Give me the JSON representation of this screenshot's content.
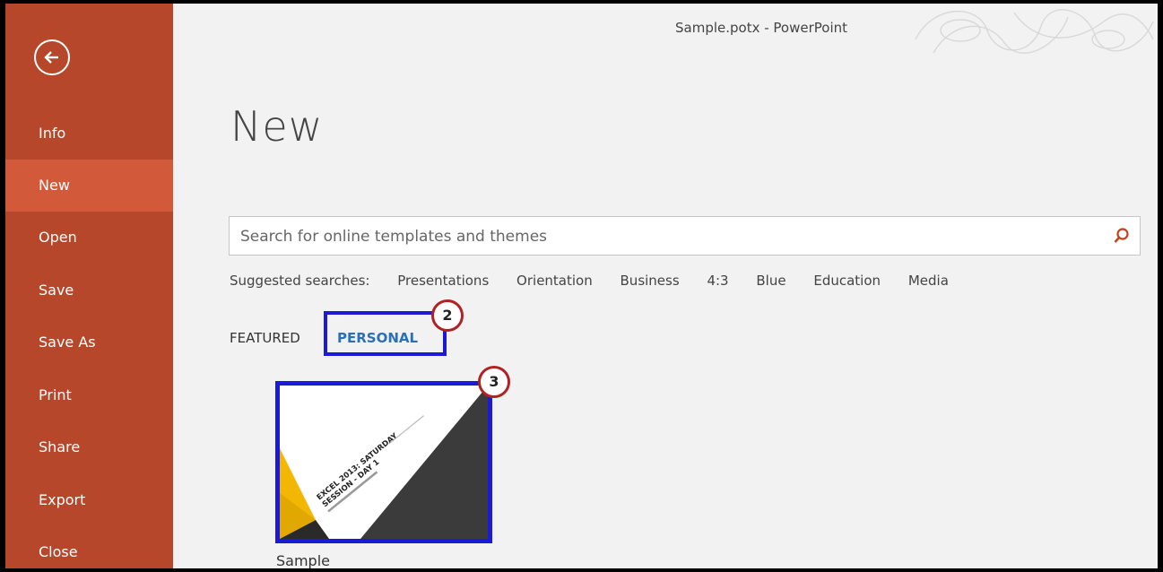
{
  "window": {
    "title": "Sample.potx - PowerPoint"
  },
  "sidebar": {
    "items": [
      {
        "label": "Info",
        "active": false
      },
      {
        "label": "New",
        "active": true
      },
      {
        "label": "Open",
        "active": false
      },
      {
        "label": "Save",
        "active": false
      },
      {
        "label": "Save As",
        "active": false
      },
      {
        "label": "Print",
        "active": false
      },
      {
        "label": "Share",
        "active": false
      },
      {
        "label": "Export",
        "active": false
      },
      {
        "label": "Close",
        "active": false
      }
    ]
  },
  "main": {
    "title": "New",
    "search": {
      "placeholder": "Search for online templates and themes",
      "value": ""
    },
    "suggested": {
      "label": "Suggested searches:",
      "items": [
        "Presentations",
        "Orientation",
        "Business",
        "4:3",
        "Blue",
        "Education",
        "Media"
      ]
    },
    "tabs": [
      {
        "label": "FEATURED",
        "active": false
      },
      {
        "label": "PERSONAL",
        "active": true
      }
    ],
    "templates": [
      {
        "name": "Sample",
        "thumbnail_lines": [
          "EXCEL 2013: SATURDAY",
          "SESSION - DAY 1"
        ]
      }
    ]
  },
  "callouts": [
    "2",
    "3"
  ],
  "colors": {
    "sidebar": "#b7472a",
    "sidebar_active": "#d2593a",
    "highlight_box": "#1a1ad8",
    "callout_ring": "#b22222",
    "tab_active": "#2b6fb5"
  }
}
